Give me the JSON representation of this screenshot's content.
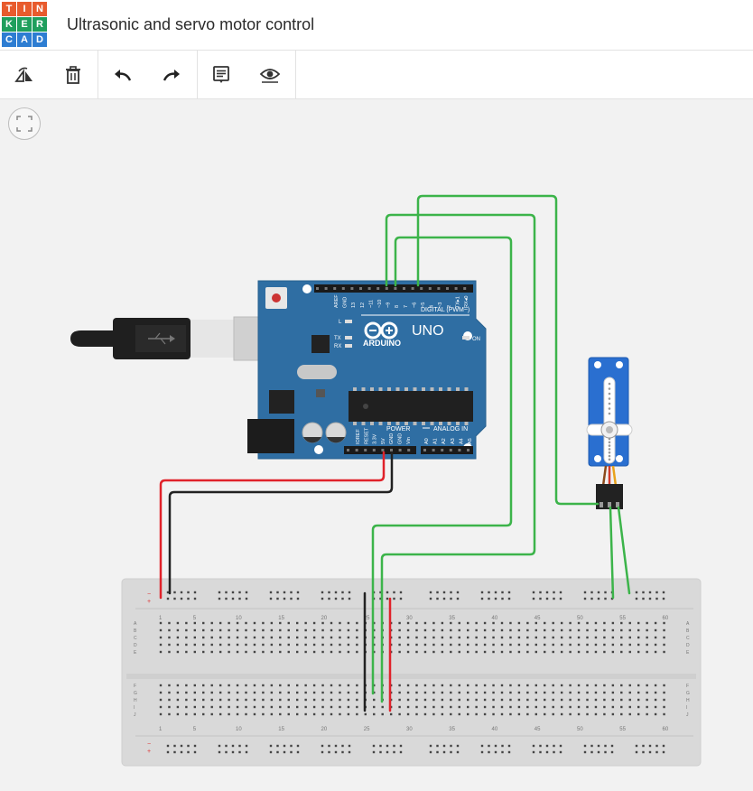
{
  "app": {
    "logo_letters": [
      "T",
      "I",
      "N",
      "K",
      "E",
      "R",
      "C",
      "A",
      "D"
    ],
    "logo_colors": [
      "#e85b2d",
      "#e85b2d",
      "#e85b2d",
      "#1f9f5d",
      "#1f9f5d",
      "#1f9f5d",
      "#2d7dd2",
      "#2d7dd2",
      "#2d7dd2"
    ],
    "title": "Ultrasonic and servo motor control"
  },
  "toolbar": {
    "rotate_icon": "rotate-icon",
    "delete_icon": "trash-icon",
    "undo_icon": "undo-arrow-icon",
    "redo_icon": "redo-arrow-icon",
    "notes_icon": "notes-icon",
    "visibility_icon": "eye-icon"
  },
  "canvas": {
    "fit_view_icon": "fit-view-icon"
  },
  "arduino": {
    "brand": "ARDUINO",
    "model": "UNO",
    "digital_header": "DIGITAL (PWM~)",
    "analog_header": "ANALOG IN",
    "power_header": "POWER",
    "on_label": "ON",
    "l_label": "L",
    "tx_label": "TX",
    "rx_label": "RX",
    "digital_pins": [
      "AREF",
      "GND",
      "13",
      "12",
      "~11",
      "~10",
      "~9",
      "8",
      "7",
      "~6",
      "~5",
      "4",
      "~3",
      "2",
      "TX▸1",
      "RX◂0"
    ],
    "power_pins": [
      "IOREF",
      "RESET",
      "3.3V",
      "5V",
      "GND",
      "GND",
      "Vin"
    ],
    "analog_pins": [
      "A0",
      "A1",
      "A2",
      "A3",
      "A4",
      "A5"
    ]
  },
  "breadboard": {
    "column_numbers": [
      "1",
      "5",
      "10",
      "15",
      "20",
      "25",
      "30",
      "35",
      "40",
      "45",
      "50",
      "55",
      "60"
    ],
    "row_letters_top": [
      "A",
      "B",
      "C",
      "D",
      "E"
    ],
    "row_letters_bottom": [
      "F",
      "G",
      "H",
      "I",
      "J"
    ],
    "rail_minus": "−",
    "rail_plus": "+"
  },
  "colors": {
    "wire_green": "#3cb44a",
    "wire_red": "#e0222a",
    "wire_black": "#222222",
    "board_blue": "#2f6ea3",
    "servo_blue": "#2a6fd0"
  }
}
